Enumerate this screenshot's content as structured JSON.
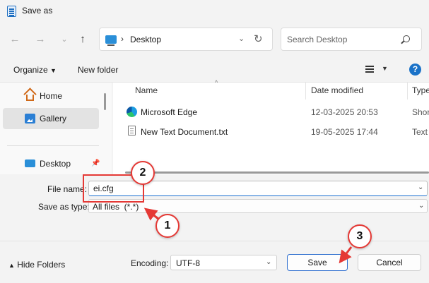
{
  "window": {
    "title": "Save as",
    "icon": "notepad-icon"
  },
  "nav": {
    "back_icon": "arrow-left-icon",
    "forward_icon": "arrow-right-icon",
    "recent_icon": "chevron-down-icon",
    "up_icon": "arrow-up-icon",
    "path_separator": "›",
    "path": "Desktop",
    "search_placeholder": "Search Desktop"
  },
  "commands": {
    "organize": "Organize",
    "new_folder": "New folder",
    "help": "?"
  },
  "sidebar": {
    "items": [
      {
        "label": "Home",
        "icon": "home-icon",
        "selected": false
      },
      {
        "label": "Gallery",
        "icon": "gallery-icon",
        "selected": true
      },
      {
        "label": "Desktop",
        "icon": "desktop-icon",
        "pinned": true
      }
    ]
  },
  "file_list": {
    "columns": [
      "Name",
      "Date modified",
      "Type"
    ],
    "rows": [
      {
        "name": "Microsoft Edge",
        "date": "12-03-2025 20:53",
        "type": "Shor",
        "icon": "edge-icon"
      },
      {
        "name": "New Text Document.txt",
        "date": "19-05-2025 17:44",
        "type": "Text",
        "icon": "text-file-icon"
      }
    ]
  },
  "form": {
    "file_name_label": "File name:",
    "file_name_value": "ei.cfg",
    "save_as_type_label": "Save as type:",
    "save_as_type_value": "All files  (*.*)",
    "encoding_label": "Encoding:",
    "encoding_value": "UTF-8"
  },
  "footer": {
    "hide_folders": "Hide Folders",
    "save": "Save",
    "cancel": "Cancel"
  },
  "annotations": {
    "badges": [
      "1",
      "2",
      "3"
    ],
    "color": "#e53935"
  },
  "colors": {
    "accent": "#1a6fd0",
    "selection": "#e3e3e3"
  }
}
